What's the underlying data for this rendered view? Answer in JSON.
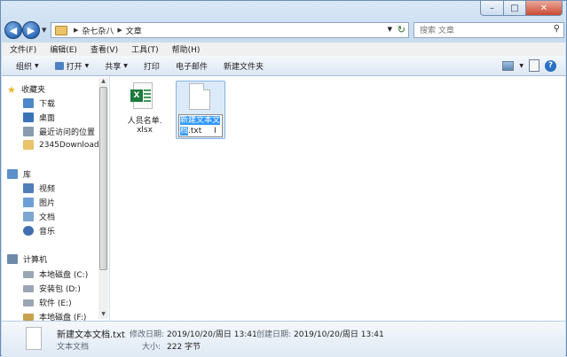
{
  "breadcrumb": [
    "杂七杂八",
    "文章"
  ],
  "search": {
    "placeholder": "搜索 文章"
  },
  "menu": [
    "文件(F)",
    "编辑(E)",
    "查看(V)",
    "工具(T)",
    "帮助(H)"
  ],
  "toolbar": {
    "organize": "组织",
    "open": "打开",
    "share": "共享",
    "print": "打印",
    "email": "电子邮件",
    "new_folder": "新建文件夹"
  },
  "sidebar": {
    "favorites": "收藏夹",
    "fav_items": [
      "下载",
      "桌面",
      "最近访问的位置",
      "2345Downloads"
    ],
    "library": "库",
    "lib_items": [
      "视频",
      "图片",
      "文档",
      "音乐"
    ],
    "computer": "计算机",
    "drives": [
      "本地磁盘 (C:)",
      "安装包 (D:)",
      "软件 (E:)",
      "本地磁盘 (F:)"
    ]
  },
  "files": {
    "xlsx_name_1": "人员名单.",
    "xlsx_name_2": "xlsx",
    "rename_sel_1": "新建文本文",
    "rename_sel_2": "档",
    "rename_ext": ".txt"
  },
  "details": {
    "filename": "新建文本文档.txt",
    "modified_label": "修改日期:",
    "modified": "2019/10/20/周日 13:41",
    "created_label": "创建日期:",
    "created": "2019/10/20/周日 13:41",
    "type": "文本文档",
    "size_label": "大小:",
    "size": "222 字节"
  },
  "colors": {
    "accent": "#3399ff",
    "excel": "#1f7a3d",
    "folder": "#e9c26a"
  },
  "icons": [
    "back-arrow-icon",
    "forward-arrow-icon",
    "folder-icon",
    "refresh-icon",
    "search-icon",
    "star-icon",
    "library-icon",
    "computer-icon",
    "drive-icon",
    "excel-file-icon",
    "text-file-icon",
    "help-icon"
  ]
}
